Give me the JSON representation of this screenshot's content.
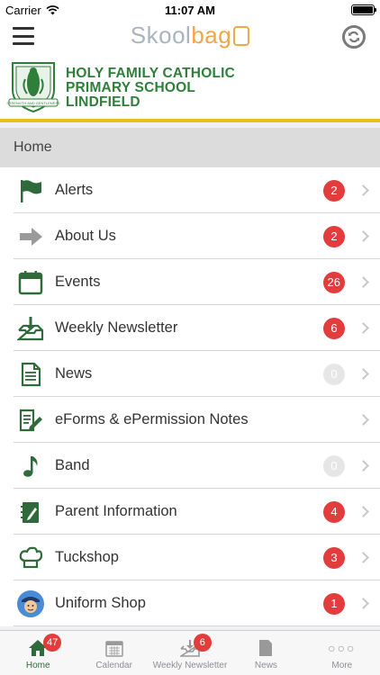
{
  "status_bar": {
    "carrier": "Carrier",
    "time": "11:07 AM"
  },
  "nav": {
    "logo_part1": "Skool",
    "logo_part2": "bag",
    "menu_icon": "hamburger-icon",
    "sync_icon": "sync-icon"
  },
  "school": {
    "name_line1": "HOLY FAMILY CATHOLIC",
    "name_line2": "PRIMARY SCHOOL",
    "name_line3": "LINDFIELD",
    "crest_motto": "STRENGTH AND GENTLENESS"
  },
  "section_title": "Home",
  "menu": [
    {
      "label": "Alerts",
      "badge": "2",
      "icon": "flag-icon"
    },
    {
      "label": "About Us",
      "badge": "2",
      "icon": "arrow-right-icon"
    },
    {
      "label": "Events",
      "badge": "26",
      "icon": "calendar-icon"
    },
    {
      "label": "Weekly Newsletter",
      "badge": "6",
      "icon": "inbox-download-icon"
    },
    {
      "label": "News",
      "badge": "0",
      "icon": "document-icon"
    },
    {
      "label": "eForms & ePermission Notes",
      "badge": "",
      "icon": "form-pen-icon"
    },
    {
      "label": "Band",
      "badge": "0",
      "icon": "music-note-icon"
    },
    {
      "label": "Parent Information",
      "badge": "4",
      "icon": "notebook-icon"
    },
    {
      "label": "Tuckshop",
      "badge": "3",
      "icon": "chef-hat-icon"
    },
    {
      "label": "Uniform Shop",
      "badge": "1",
      "icon": "uniform-avatar-icon"
    }
  ],
  "tabs": [
    {
      "label": "Home",
      "badge": "47",
      "icon": "home-icon"
    },
    {
      "label": "Calendar",
      "badge": "",
      "icon": "calendar-icon"
    },
    {
      "label": "Weekly Newsletter",
      "badge": "6",
      "icon": "inbox-download-icon"
    },
    {
      "label": "News",
      "badge": "",
      "icon": "document-icon"
    },
    {
      "label": "More",
      "badge": "",
      "icon": "more-icon"
    }
  ],
  "colors": {
    "brand_green": "#2f7f3a",
    "badge_red": "#e23c3c",
    "gold": "#e8c21c",
    "logo_orange": "#f0a64a"
  }
}
